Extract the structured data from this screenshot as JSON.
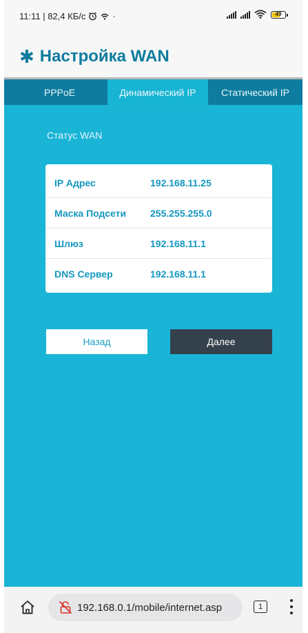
{
  "status_bar": {
    "left_text": "11:11 | 82,4 КБ/с",
    "dot": "·",
    "battery_level": "49",
    "icons": [
      "alarm-icon",
      "hotspot-icon",
      "signal-icon",
      "signal-icon",
      "wifi-icon",
      "battery-icon"
    ]
  },
  "header": {
    "title": "Настройка WAN",
    "icon": "asterisk-icon"
  },
  "tabs": [
    {
      "label": "PPPoE",
      "active": false
    },
    {
      "label": "Динамический IP",
      "active": true
    },
    {
      "label": "Статический IP",
      "active": false
    }
  ],
  "main": {
    "section_label": "Статус WAN",
    "rows": [
      {
        "key": "IP Адрес",
        "value": "192.168.11.25"
      },
      {
        "key": "Маска Подсети",
        "value": "255.255.255.0"
      },
      {
        "key": "Шлюз",
        "value": "192.168.11.1"
      },
      {
        "key": "DNS Сервер",
        "value": "192.168.11.1"
      }
    ],
    "back_label": "Назад",
    "next_label": "Далее"
  },
  "browser": {
    "url": "192.168.0.1/mobile/internet.asp",
    "tab_count": "1",
    "icons": [
      "home-icon",
      "insecure-lock-icon",
      "tabs-icon",
      "more-menu-icon"
    ]
  },
  "colors": {
    "accent": "#0e7c9e",
    "panel": "#19b4d6",
    "active_tab": "#17b4d3",
    "value_text": "#1497c0",
    "next_button": "#34404b"
  }
}
